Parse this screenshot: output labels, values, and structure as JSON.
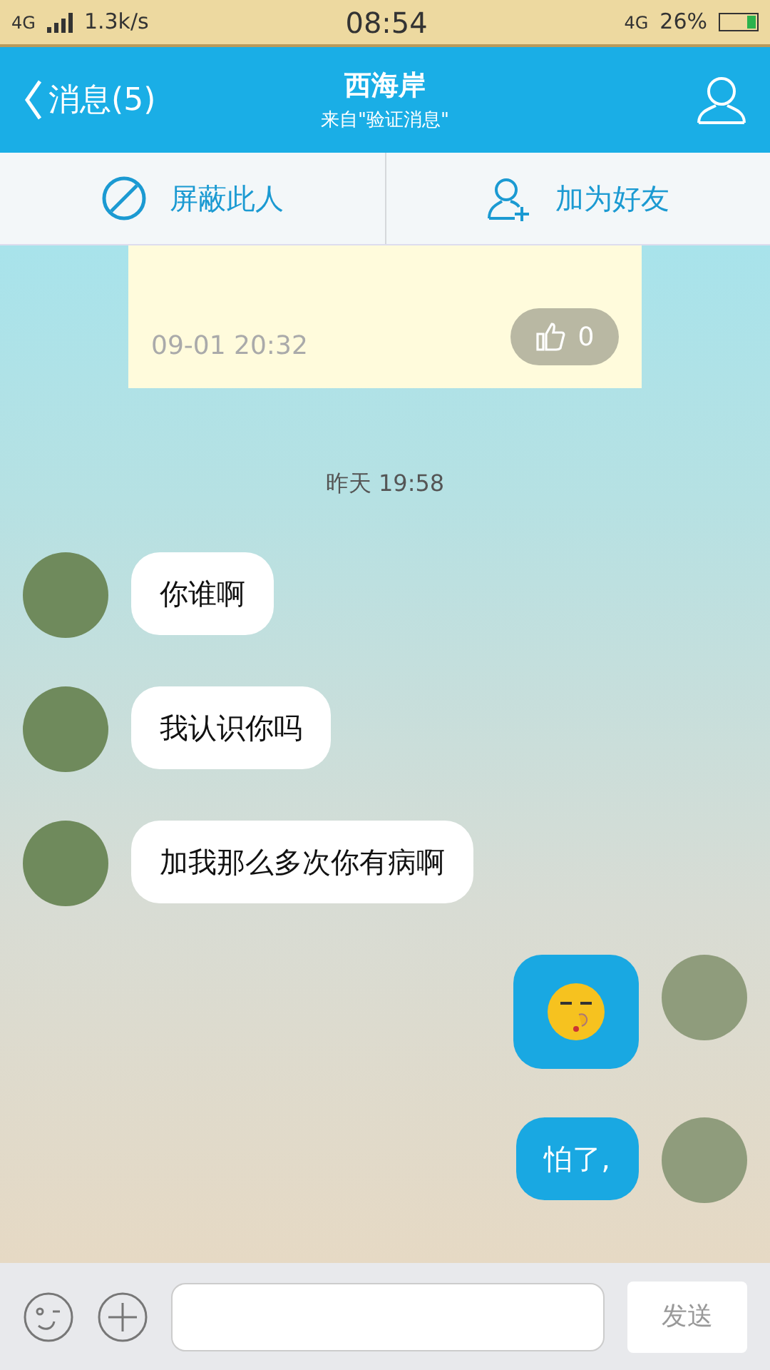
{
  "status_bar": {
    "network_top": "4G",
    "speed": "1.3k/s",
    "time": "08:54",
    "network_right": "4G",
    "battery_percent": "26%"
  },
  "header": {
    "back_label": "消息(5)",
    "title": "西海岸",
    "subtitle": "来自\"验证消息\""
  },
  "actions": [
    {
      "kind": "block",
      "label": "屏蔽此人"
    },
    {
      "kind": "add",
      "label": "加为好友"
    }
  ],
  "note_card": {
    "date": "09-01 20:32",
    "likes": "0"
  },
  "timestamp": "昨天 19:58",
  "messages": [
    {
      "sent": false,
      "kind": "text",
      "text": "你谁啊"
    },
    {
      "sent": false,
      "kind": "text",
      "text": "我认识你吗"
    },
    {
      "sent": false,
      "kind": "text",
      "text": "加我那么多次你有病啊"
    },
    {
      "sent": true,
      "kind": "emoji"
    },
    {
      "sent": true,
      "kind": "text",
      "text": "怕了,"
    }
  ],
  "input_bar": {
    "send_label": "发送"
  }
}
